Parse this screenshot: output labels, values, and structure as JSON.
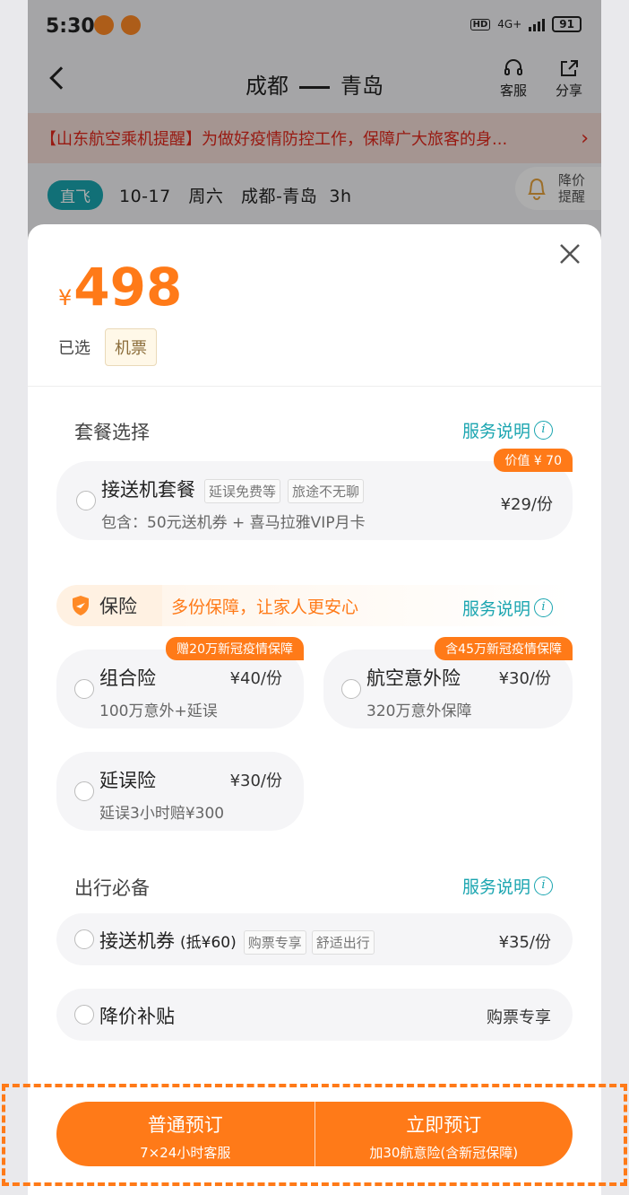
{
  "status_bar": {
    "time": "5:30",
    "network": "4G+",
    "battery": "91",
    "hd": "HD"
  },
  "header": {
    "origin": "成都",
    "destination": "青岛",
    "service_label": "客服",
    "share_label": "分享"
  },
  "notice": {
    "text": "【山东航空乘机提醒】为做好疫情防控工作，保障广大旅客的身...",
    "chevron": "›"
  },
  "flight": {
    "tag": "直飞",
    "info": "10-17   周六   成都-青岛  3h",
    "alert_line1": "降价",
    "alert_line2": "提醒"
  },
  "sheet": {
    "currency": "¥",
    "price": "498",
    "selected_label": "已选",
    "selected_chip": "机票"
  },
  "package_section": {
    "title": "套餐选择",
    "link": "服务说明",
    "card": {
      "title": "接送机套餐",
      "tags": [
        "延误免费等",
        "旅途不无聊"
      ],
      "sub": "包含：50元送机券 + 喜马拉雅VIP月卡",
      "price": "¥29/份",
      "ribbon": "价值 ¥ 70"
    }
  },
  "insurance_section": {
    "label": "保险",
    "slogan": "多份保障，让家人更安心",
    "link": "服务说明",
    "items": [
      {
        "title": "组合险",
        "price": "¥40/份",
        "sub": "100万意外+延误",
        "ribbon": "赠20万新冠疫情保障"
      },
      {
        "title": "航空意外险",
        "price": "¥30/份",
        "sub": "320万意外保障",
        "ribbon": "含45万新冠疫情保障"
      },
      {
        "title": "延误险",
        "price": "¥30/份",
        "sub": "延误3小时赔¥300",
        "ribbon": ""
      }
    ]
  },
  "travel_section": {
    "title": "出行必备",
    "link": "服务说明",
    "voucher": {
      "title": "接送机券",
      "note": "(抵¥60)",
      "tags": [
        "购票专享",
        "舒适出行"
      ],
      "price": "¥35/份"
    },
    "subsidy": {
      "title": "降价补贴",
      "right": "购票专享"
    }
  },
  "cta": {
    "normal_title": "普通预订",
    "normal_sub": "7×24小时客服",
    "instant_title": "立即预订",
    "instant_sub": "加30航意险(含新冠保障)"
  },
  "colors": {
    "accent": "#ff7a18",
    "teal": "#1aa5b0",
    "notice_red": "#e0271b"
  }
}
